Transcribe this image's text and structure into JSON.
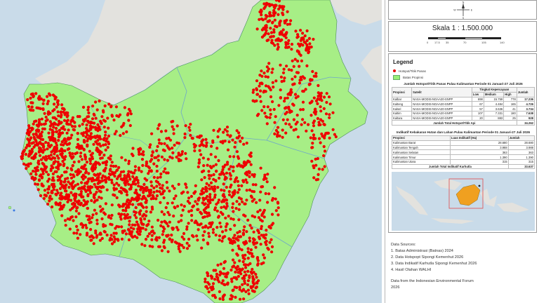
{
  "map": {
    "colors": {
      "sea": "#c9dbe9",
      "land_gray": "#e3e2de",
      "kalimantan": "#a7ee86",
      "hotspot": "#ee0000",
      "boundary": "#6fa7c9"
    },
    "hotspot_density": "very high"
  },
  "panel": {
    "north_arrow": {
      "icon": "north-arrow-icon",
      "letters": {
        "n": "N",
        "e": "E",
        "s": "S",
        "w": "W"
      }
    },
    "scale": {
      "label": "Skala 1 : 1.500.000",
      "ticks": [
        "0",
        "17.5",
        "35",
        "70",
        "105",
        "140"
      ]
    },
    "legend": {
      "title": "Legend",
      "items": [
        {
          "label": "Hotspot/Titik Panas",
          "icon": "hotspot-dot-icon"
        },
        {
          "label": "Batas Propinsi",
          "icon": "province-swatch-icon"
        }
      ]
    },
    "hotspot_table": {
      "title": "Jumlah Hotspot/Titik Panas Pulau Kalimantan Periode 01 Januari-27 Juli 2026",
      "group_header": "Tingkat Kepercayaan",
      "headers": [
        "Propinsi",
        "Satelit",
        "Low",
        "Medium",
        "High",
        "Jumlah"
      ],
      "rows": [
        [
          "Kalbar",
          "NASA-MODIS-NOAA20-SNPP",
          "698",
          "15.759",
          "778",
          "17.236"
        ],
        [
          "Kalteng",
          "NASA-MODIS-NOAA20-SNPP",
          "67",
          "4.484",
          "165",
          "4.726"
        ],
        [
          "Kalsel",
          "NASA-MODIS-NOAA20-SNPP",
          "57",
          "3.636",
          "41",
          "3.734"
        ],
        [
          "Kaltim",
          "NASA-MODIS-NOAA20-SNPP",
          "107",
          "7.331",
          "180",
          "7.638"
        ],
        [
          "Kaltara",
          "NASA-MODIS-NOAA20-SNPP",
          "20",
          "883",
          "25",
          "928"
        ]
      ],
      "total_label": "Jumlah Total Hotspot/Titik Api",
      "total_value": "34.262"
    },
    "burn_table": {
      "title": "Indikatif Kebakaran Hutan dan Lahan Pulau Kalimantan Periode 01 Januari-27 Juli 2026",
      "headers": [
        "Propinsi",
        "Luas Indikatif (Ha)",
        "Jumlah"
      ],
      "rows": [
        [
          "Kalimantan Barat",
          "28.680",
          "28.680"
        ],
        [
          "Kalimantan Tengah",
          "3.988",
          "3.988"
        ],
        [
          "Kalimantan Selatan",
          "363",
          "363"
        ],
        [
          "Kalimantan Timur",
          "1.390",
          "1.390"
        ],
        [
          "Kalimantan Utara",
          "315",
          "315"
        ]
      ],
      "total_label": "Jumlah Total Indikatif Karhutla",
      "total_value": "33.637"
    },
    "sources": {
      "heading": "Data Sources:",
      "items": [
        "1. Batas Administrasi (Batnas) 2024",
        "2. Data Hotspopt Sipongi Kemenhut 2026",
        "3. Data Indikatif Karhutla Sipongi Kemenhut 2026",
        "4. Hasil Olahan WALHI"
      ],
      "footer_line1": "Data from the Indonesian Environmental Forum",
      "footer_line2": "2026"
    }
  }
}
